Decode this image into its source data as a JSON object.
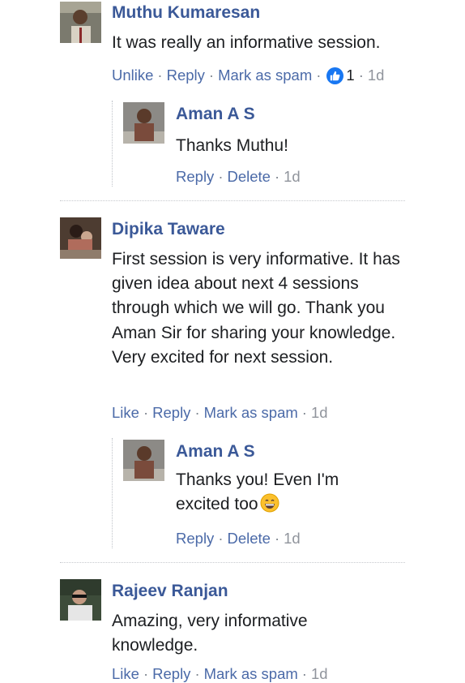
{
  "comments": [
    {
      "author": "Muthu Kumaresan",
      "text": "It was really an informative session.",
      "actions": {
        "like": "Unlike",
        "reply": "Reply",
        "spam": "Mark as spam",
        "likes": "1",
        "time": "1d"
      },
      "replies": [
        {
          "author": "Aman A S",
          "text": "Thanks Muthu!",
          "actions": {
            "reply": "Reply",
            "delete": "Delete",
            "time": "1d"
          }
        }
      ]
    },
    {
      "author": "Dipika Taware",
      "text": "First session is very informative. It has given idea about next 4 sessions through which we will go. Thank you Aman Sir for sharing your knowledge. Very excited for next session.",
      "actions": {
        "like": "Like",
        "reply": "Reply",
        "spam": "Mark as spam",
        "time": "1d"
      },
      "replies": [
        {
          "author": "Aman A S",
          "text": "Thanks you! Even I'm excited too",
          "emoji": "grinning-face",
          "actions": {
            "reply": "Reply",
            "delete": "Delete",
            "time": "1d"
          }
        }
      ]
    },
    {
      "author": "Rajeev Ranjan",
      "text": "Amazing, very informative knowledge.",
      "actions": {
        "like": "Like",
        "reply": "Reply",
        "spam": "Mark as spam",
        "time": "1d"
      }
    }
  ],
  "separator": "·",
  "colors": {
    "link": "#4b6aa8",
    "author": "#3b5998",
    "like_badge": "#1877f2"
  }
}
